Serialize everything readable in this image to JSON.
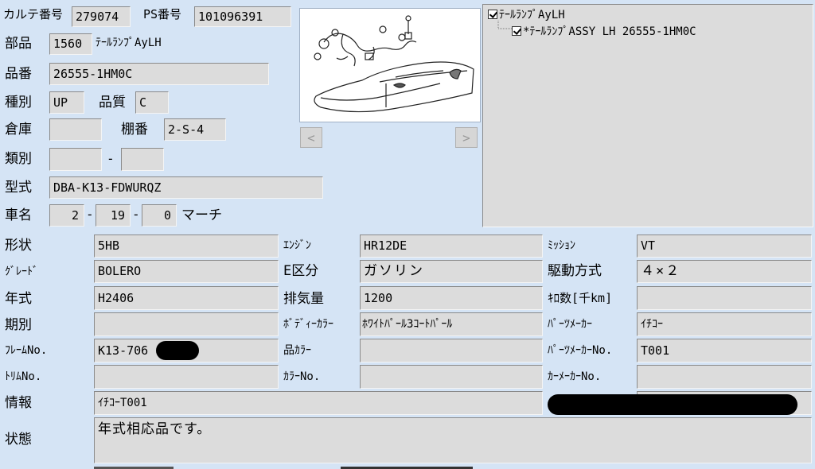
{
  "karte": {
    "label": "カルテ番号",
    "value": "279074"
  },
  "ps": {
    "label": "PS番号",
    "value": "101096391"
  },
  "buhin": {
    "label": "部品",
    "code": "1560",
    "name": "ﾃｰﾙﾗﾝﾌﾟAyLH"
  },
  "hinban": {
    "label": "品番",
    "value": "26555-1HM0C"
  },
  "shubetsu": {
    "label": "種別",
    "value": "UP"
  },
  "hinshitsu": {
    "label": "品質",
    "value": "C"
  },
  "souko": {
    "label": "倉庫",
    "value": ""
  },
  "tanaban": {
    "label": "棚番",
    "value": "2-S-4"
  },
  "ruibetsu": {
    "label": "類別",
    "value1": "",
    "dash": "-",
    "value2": ""
  },
  "katashiki": {
    "label": "型式",
    "value": "DBA-K13-FDWURQZ"
  },
  "shamei": {
    "label": "車名",
    "v1": "2",
    "v2": "19",
    "v3": "0",
    "dash": "-",
    "name": "マーチ"
  },
  "image_nav": {
    "prev": "<",
    "next": ">"
  },
  "tree": {
    "root": {
      "label": "ﾃｰﾙﾗﾝﾌﾟAyLH",
      "checked": true
    },
    "child": {
      "label": "*ﾃｰﾙﾗﾝﾌﾟASSY LH    26555-1HM0C",
      "checked": true
    }
  },
  "grid": {
    "keijou": {
      "label": "形状",
      "value": "5HB"
    },
    "engine": {
      "label": "ｴﾝｼﾞﾝ",
      "value": "HR12DE"
    },
    "mission": {
      "label": "ﾐｯｼｮﾝ",
      "value": "VT"
    },
    "grade": {
      "label": "ｸﾞﾚｰﾄﾞ",
      "value": "BOLERO"
    },
    "ekubun": {
      "label": "E区分",
      "value": "ガソリン"
    },
    "kudou": {
      "label": "駆動方式",
      "value": "４×２"
    },
    "nenshiki": {
      "label": "年式",
      "value": "H2406"
    },
    "haikiryou": {
      "label": "排気量",
      "value": "1200"
    },
    "kilo": {
      "label": "ｷﾛ数[千km]",
      "value": ""
    },
    "kibetsu": {
      "label": "期別",
      "value": ""
    },
    "bodycolor": {
      "label": "ﾎﾞﾃﾞｨｰｶﾗｰ",
      "value": "ﾎﾜｲﾄﾊﾟｰﾙ3ｺｰﾄﾊﾟｰﾙ"
    },
    "partsmaker": {
      "label": "ﾊﾟｰﾂﾒｰｶｰ",
      "value": "ｲﾁｺｰ"
    },
    "frame": {
      "label": "ﾌﾚｰﾑNo.",
      "value": "K13-706"
    },
    "hincolor": {
      "label": "品ｶﾗｰ",
      "value": ""
    },
    "partsmakerno": {
      "label": "ﾊﾟｰﾂﾒｰｶｰNo.",
      "value": "T001"
    },
    "trim": {
      "label": "ﾄﾘﾑNo.",
      "value": ""
    },
    "colorno": {
      "label": "ｶﾗｰNo.",
      "value": ""
    },
    "carmakerno": {
      "label": "ｶｰﾒｰｶｰNo.",
      "value": ""
    },
    "jouhou": {
      "label": "情報",
      "value": "ｲﾁｺｰT001"
    },
    "joutai": {
      "label": "状態",
      "value": "年式相応品です。"
    }
  }
}
